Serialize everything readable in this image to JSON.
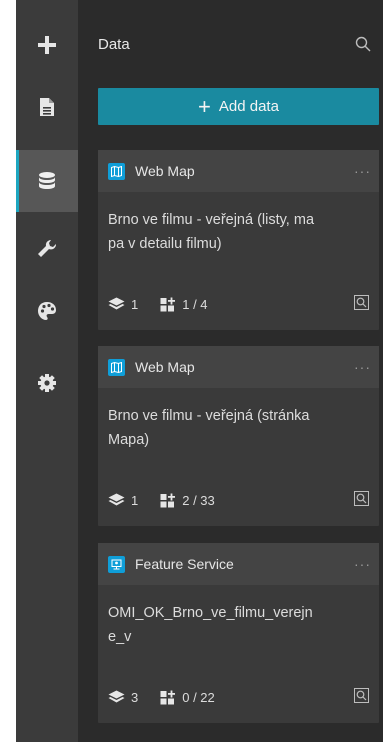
{
  "panel": {
    "title": "Data",
    "add_data_label": "Add data"
  },
  "rail": {
    "items": [
      {
        "icon": "plus-icon"
      },
      {
        "icon": "page-icon"
      },
      {
        "icon": "database-icon",
        "active": true
      },
      {
        "icon": "wrench-icon"
      },
      {
        "icon": "palette-icon"
      },
      {
        "icon": "gear-icon"
      }
    ]
  },
  "cards": [
    {
      "type": "Web Map",
      "title": "Brno ve filmu - veřejná (listy, mapa v detailu filmu)",
      "title_lines": [
        "Brno ve filmu - veřejná (listy, ma",
        "pa v detailu filmu)"
      ],
      "layers": "1",
      "fields": "1 / 4"
    },
    {
      "type": "Web Map",
      "title": "Brno ve filmu - veřejná (stránka Mapa)",
      "title_lines": [
        "Brno ve filmu - veřejná (stránka",
        "Mapa)"
      ],
      "layers": "1",
      "fields": "2 / 33"
    },
    {
      "type": "Feature Service",
      "title": "OMI_OK_Brno_ve_filmu_verejne_v",
      "title_lines": [
        "OMI_OK_Brno_ve_filmu_verejn",
        "e_v"
      ],
      "layers": "3",
      "fields": "0 / 22"
    }
  ],
  "colors": {
    "accent": "#1a8aa0",
    "rail_active": "#1da6c0",
    "badge": "#0f9ed8"
  }
}
